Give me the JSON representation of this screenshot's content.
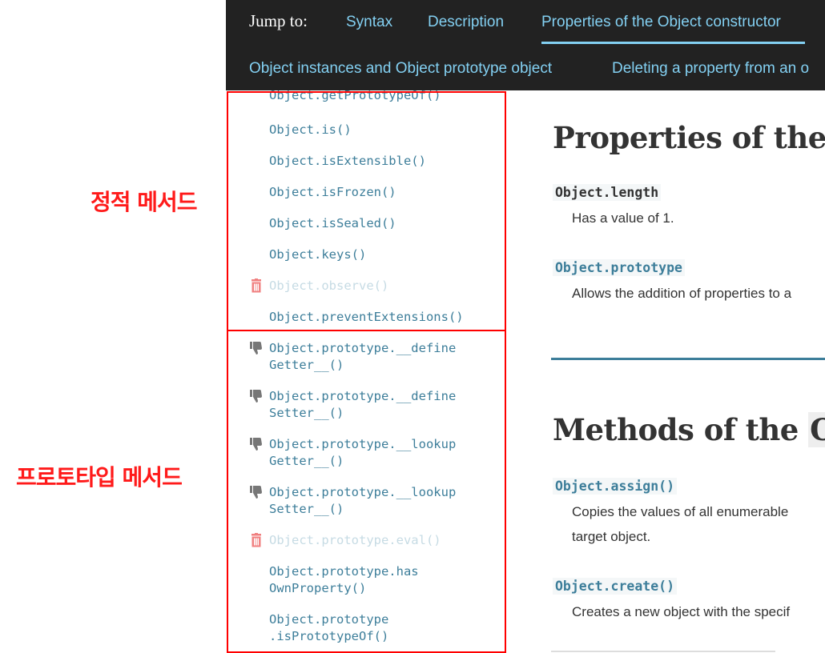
{
  "annotations": {
    "static_methods": "정적 메서드",
    "prototype_methods": "프로토타입 메서드"
  },
  "jump_bar": {
    "label": "Jump to:",
    "links": {
      "syntax": "Syntax",
      "description": "Description",
      "properties": "Properties of the Object constructor",
      "instances": "Object instances and Object prototype object",
      "deleting": "Deleting a property from an o"
    },
    "active": "properties"
  },
  "sidebar": {
    "items": [
      {
        "label": "Object.getPrototypeOf()",
        "status": "normal"
      },
      {
        "label": "Object.is()",
        "status": "normal"
      },
      {
        "label": "Object.isExtensible()",
        "status": "normal"
      },
      {
        "label": "Object.isFrozen()",
        "status": "normal"
      },
      {
        "label": "Object.isSealed()",
        "status": "normal"
      },
      {
        "label": "Object.keys()",
        "status": "normal"
      },
      {
        "label": "Object.observe()",
        "status": "obsolete",
        "icon": "trash-icon"
      },
      {
        "label": "Object.preventExtensions()",
        "status": "normal"
      },
      {
        "label": "Object.prototype.__define\nGetter__()",
        "status": "deprecated",
        "icon": "thumbs-down-icon"
      },
      {
        "label": "Object.prototype.__define\nSetter__()",
        "status": "deprecated",
        "icon": "thumbs-down-icon"
      },
      {
        "label": "Object.prototype.__lookup\nGetter__()",
        "status": "deprecated",
        "icon": "thumbs-down-icon"
      },
      {
        "label": "Object.prototype.__lookup\nSetter__()",
        "status": "deprecated",
        "icon": "thumbs-down-icon"
      },
      {
        "label": "Object.prototype.eval()",
        "status": "obsolete",
        "icon": "trash-icon"
      },
      {
        "label": "Object.prototype.has\nOwnProperty()",
        "status": "normal"
      },
      {
        "label": "Object.prototype\n.isPrototypeOf()",
        "status": "normal"
      }
    ]
  },
  "main": {
    "properties_heading": "Properties of the",
    "properties": [
      {
        "term": "Object.length",
        "description": "Has a value of 1."
      },
      {
        "term": "Object.prototype",
        "description": "Allows the addition of properties to a"
      }
    ],
    "methods_heading_prefix": "Methods of the ",
    "methods_heading_code": "O",
    "methods": [
      {
        "term": "Object.assign()",
        "description_lines": [
          "Copies the values of all enumerable",
          "target object."
        ]
      },
      {
        "term": "Object.create()",
        "description_lines": [
          "Creates a new object with the specif"
        ]
      }
    ]
  },
  "colors": {
    "annotation_red": "#ff1a1a",
    "topbar_bg": "#222222",
    "topbar_link": "#83d0f2",
    "link_blue": "#3d7e9a",
    "obsolete_link": "#c6dbe4"
  }
}
